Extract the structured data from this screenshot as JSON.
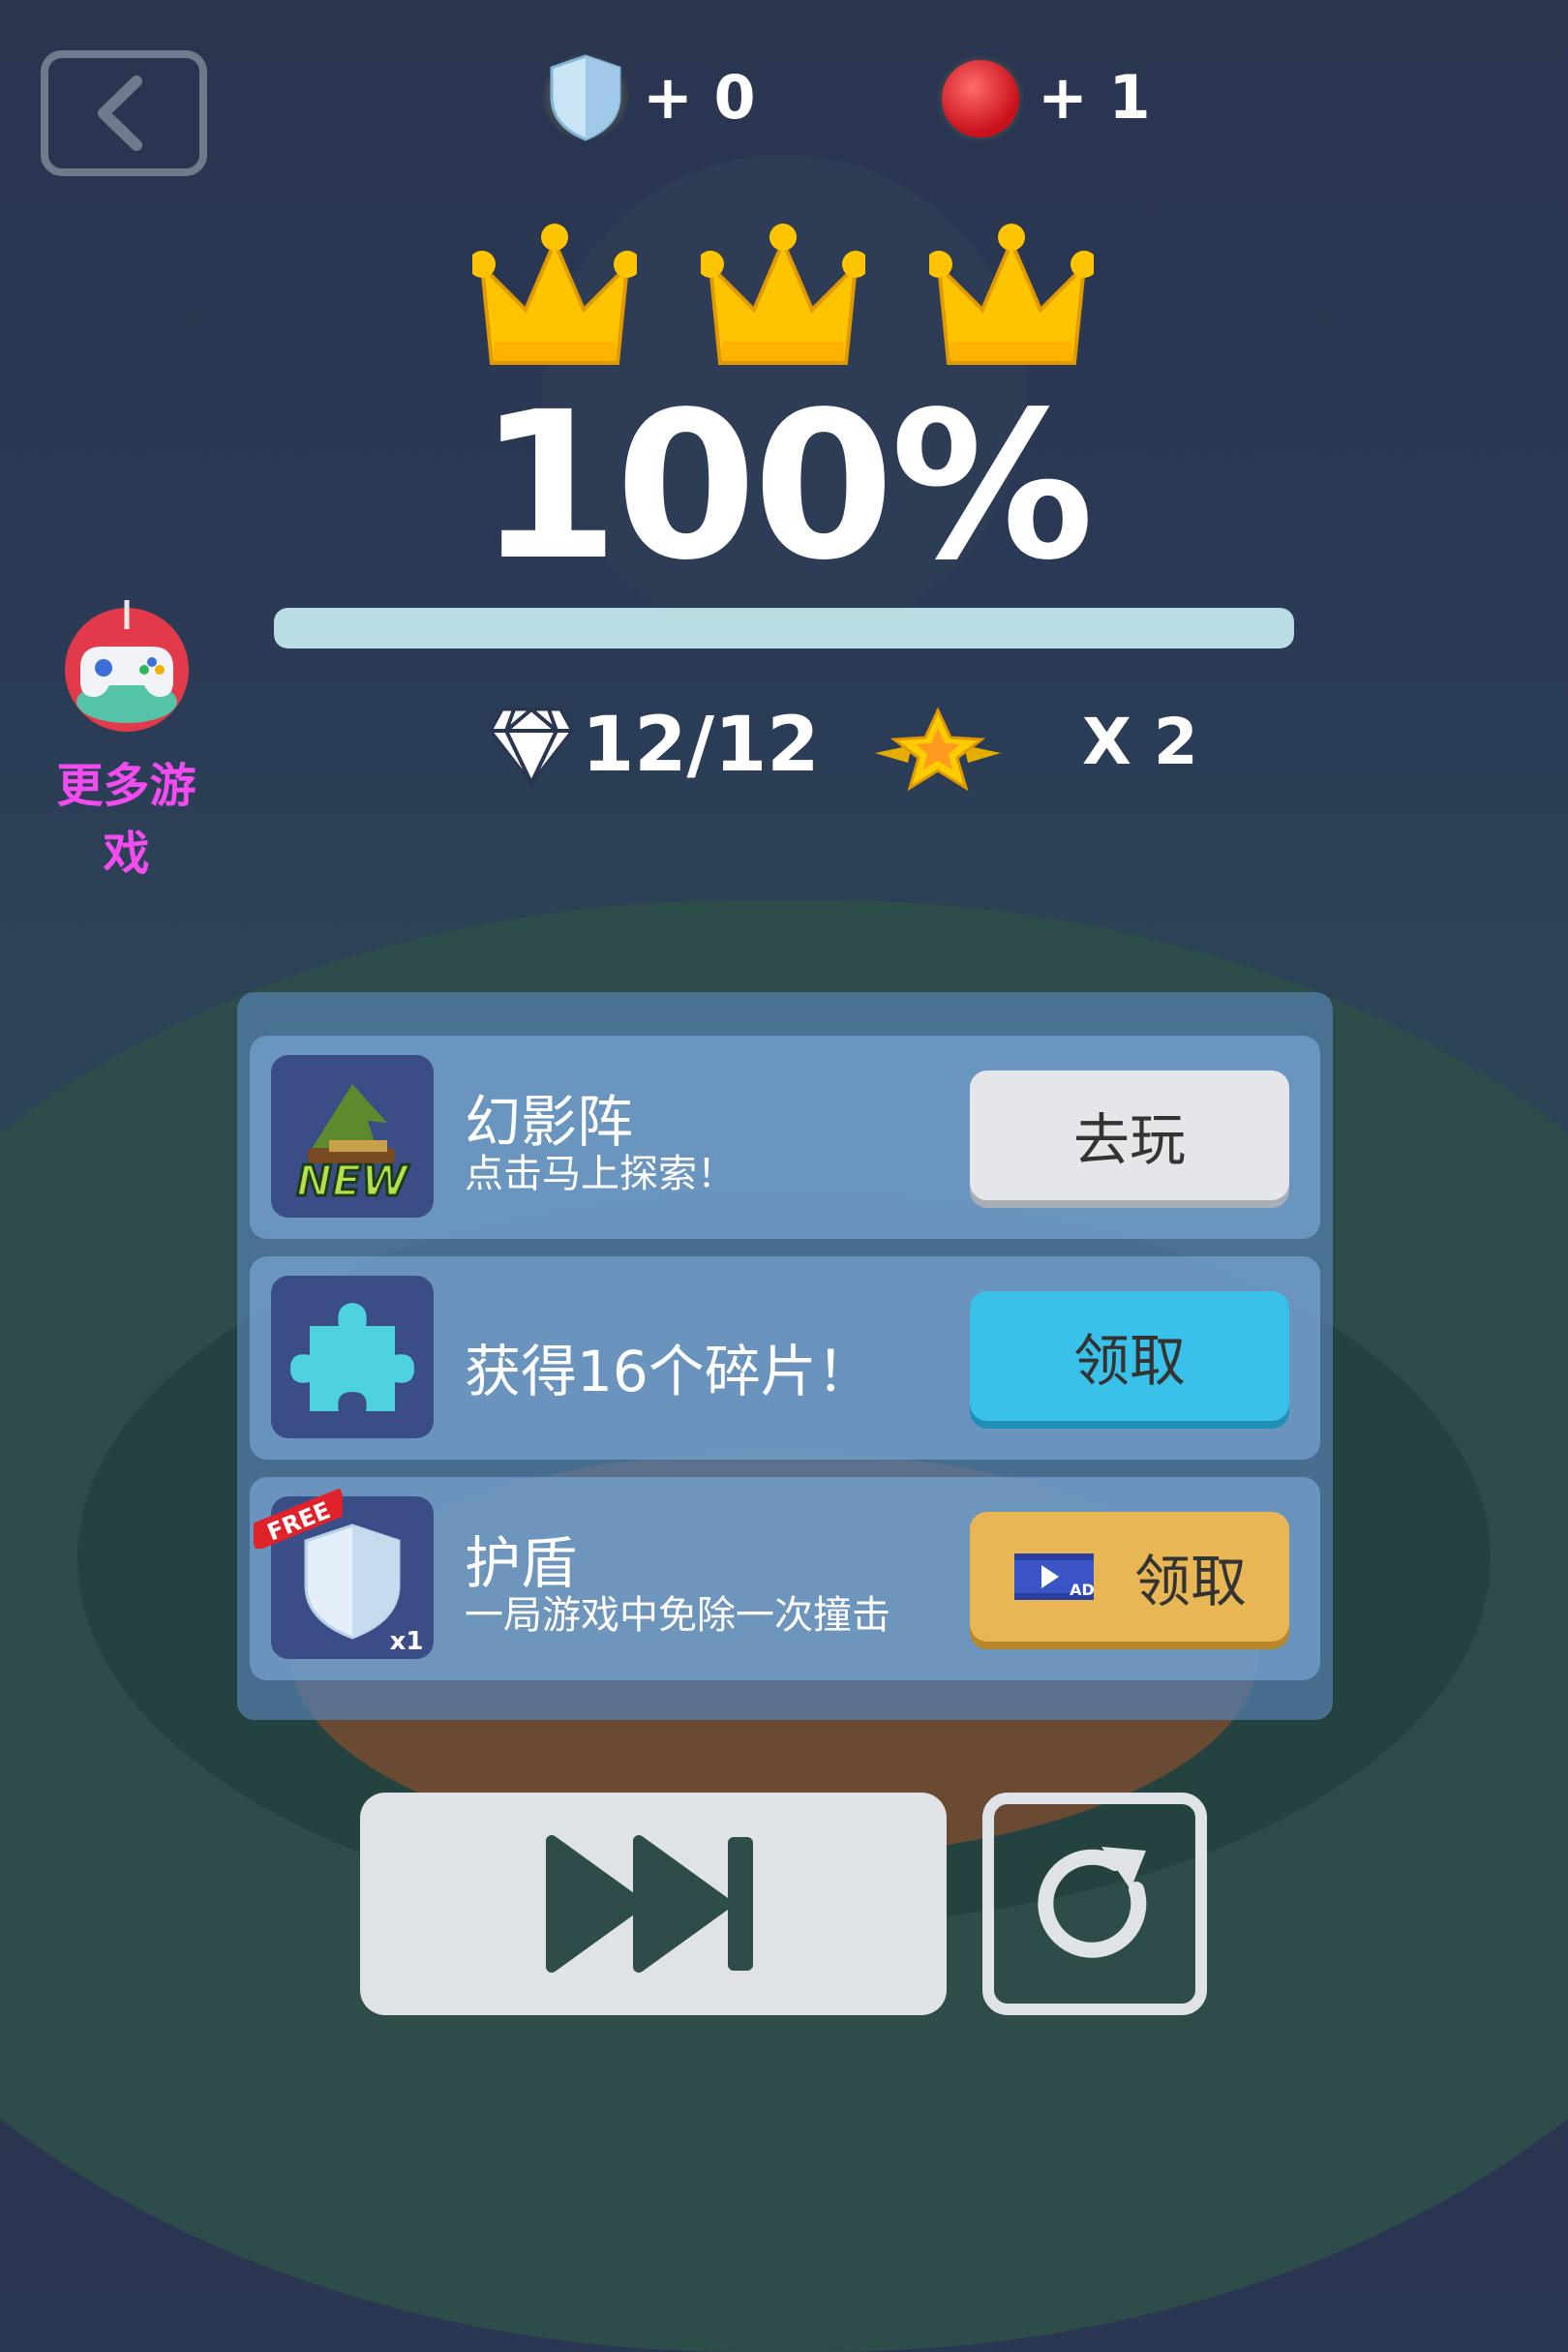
{
  "top": {
    "shield_count": "+ 0",
    "ball_count": "+ 1"
  },
  "result": {
    "crowns_earned": 3,
    "percent": "100%",
    "progress": 1.0
  },
  "more_games": {
    "label": "更多游戏"
  },
  "stats": {
    "gems": "12/12",
    "multiplier": "X 2"
  },
  "rewards": [
    {
      "title": "幻影阵",
      "subtitle": "点击马上探索！",
      "button": "去玩",
      "icon_badge": "NEW",
      "button_color": "#e4e6ea"
    },
    {
      "title": "获得16个碎片！",
      "subtitle": "",
      "button": "领取",
      "button_color": "#39c1ea"
    },
    {
      "title": "护盾",
      "subtitle": "一局游戏中免除一次撞击",
      "button": "领取",
      "icon_badge": "FREE",
      "icon_count": "x1",
      "ad_badge": "AD",
      "button_color": "#e8b654"
    }
  ],
  "colors": {
    "crown": "#ffc400",
    "progress_fill": "#b9dde3",
    "more_games_text": "#f24bf0"
  }
}
